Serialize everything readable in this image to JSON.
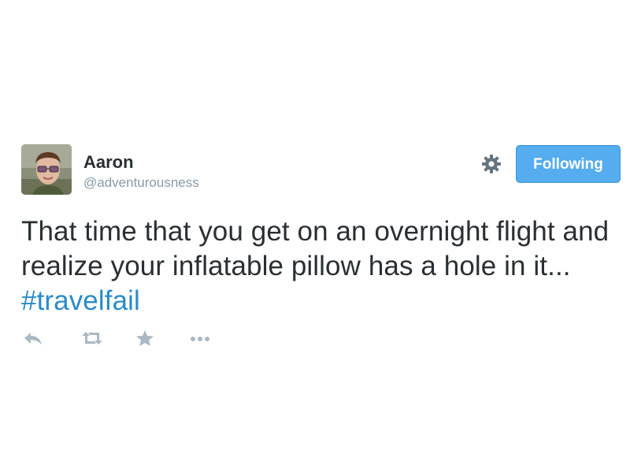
{
  "user": {
    "name": "Aaron",
    "handle": "@adventurousness"
  },
  "follow_button": {
    "label": "Following"
  },
  "tweet": {
    "text_before_hashtag": "That time that you get on an overnight flight and realize your inflatable pillow has a hole in it... ",
    "hashtag": "#travelfail"
  },
  "actions": [
    "reply-icon",
    "retweet-icon",
    "favorite-icon",
    "more-icon"
  ],
  "colors": {
    "follow_button_bg": "#55acee",
    "hashtag": "#2a8bc7",
    "text": "#292f33",
    "handle": "#8899a6",
    "icon": "#aab8c2"
  }
}
